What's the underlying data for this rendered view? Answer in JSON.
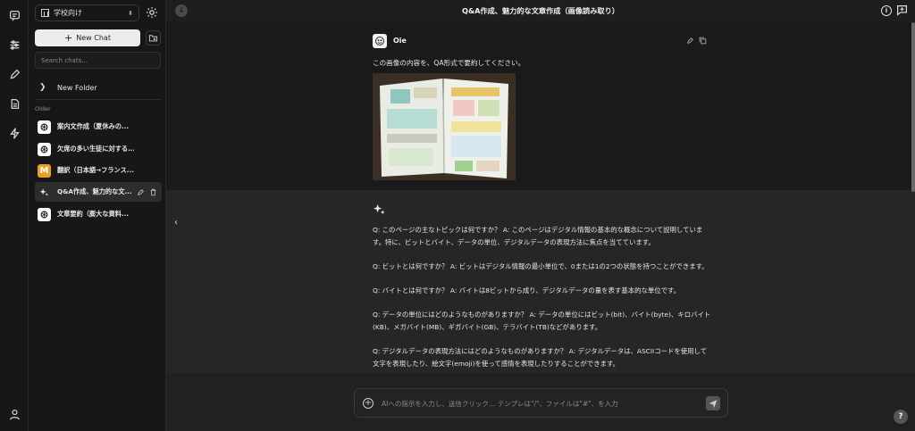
{
  "header": {
    "title": "Q&A作成、魅力的な文章作成（画像読み取り）"
  },
  "sidebar": {
    "workspace": "学校向け",
    "new_chat": "New Chat",
    "search_placeholder": "Search chats...",
    "folder": "New Folder",
    "section": "Older",
    "items": [
      {
        "label": "案内文作成（夏休みの...",
        "icon": "openai-icon"
      },
      {
        "label": "欠席の多い生徒に対する...",
        "icon": "openai-icon"
      },
      {
        "label": "翻訳（日本語→フランス...",
        "icon": "m-logo-icon"
      },
      {
        "label": "Q&A作成、魅力的な文...",
        "icon": "sparkle-icon"
      },
      {
        "label": "文章要約（膨大な資料...",
        "icon": "openai-icon"
      }
    ]
  },
  "user_message": {
    "name": "Oie",
    "text": "この画像の内容を、QA形式で要約してください。"
  },
  "ai_message": {
    "paragraphs": [
      "Q: このページの主なトピックは何ですか？ A: このページはデジタル情報の基本的な概念について説明しています。特に、ビットとバイト、データの単位、デジタルデータの表現方法に焦点を当てています。",
      "Q: ビットとは何ですか？ A: ビットはデジタル情報の最小単位で、0または1の2つの状態を持つことができます。",
      "Q: バイトとは何ですか？ A: バイトは8ビットから成り、デジタルデータの量を表す基本的な単位です。",
      "Q: データの単位にはどのようなものがありますか？ A: データの単位にはビット(bit)、バイト(byte)、キロバイト(KB)、メガバイト(MB)、ギガバイト(GB)、テラバイト(TB)などがあります。",
      "Q: デジタルデータの表現方法にはどのようなものがありますか？ A: デジタルデータは、ASCIIコードを使用して文字を表現したり、絵文字(emoji)を使って感情を表現したりすることができます。"
    ]
  },
  "composer": {
    "placeholder": "AIへの指示を入力し、送信クリック… テンプレは\"/\"、ファイルは\"#\"、を入力"
  },
  "help": "?",
  "collapse": "‹",
  "info": "i"
}
